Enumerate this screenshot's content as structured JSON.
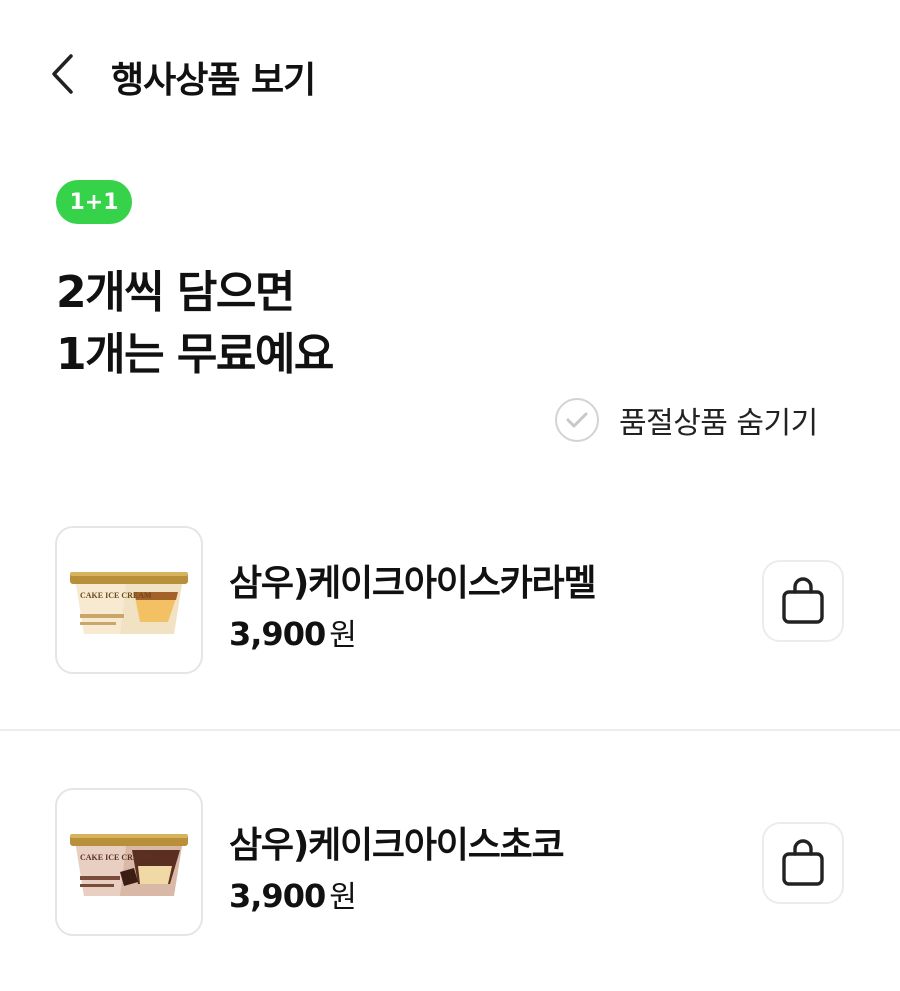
{
  "header": {
    "title": "행사상품 보기",
    "back_icon": "chevron-left-icon"
  },
  "promo": {
    "badge": "1+1",
    "badge_color": "#35d24a",
    "headline_line1": "2개씩 담으면",
    "headline_line2": "1개는 무료예요"
  },
  "filter": {
    "hide_soldout_label": "품절상품 숨기기",
    "hide_soldout_checked": false
  },
  "products": [
    {
      "name": "삼우)케이크아이스카라멜",
      "price": "3,900",
      "currency": "원",
      "thumb_label": "CAKE ICE CREAM",
      "flavor": "caramel"
    },
    {
      "name": "삼우)케이크아이스초코",
      "price": "3,900",
      "currency": "원",
      "thumb_label": "CAKE ICE CREAM",
      "flavor": "chocolate"
    }
  ]
}
